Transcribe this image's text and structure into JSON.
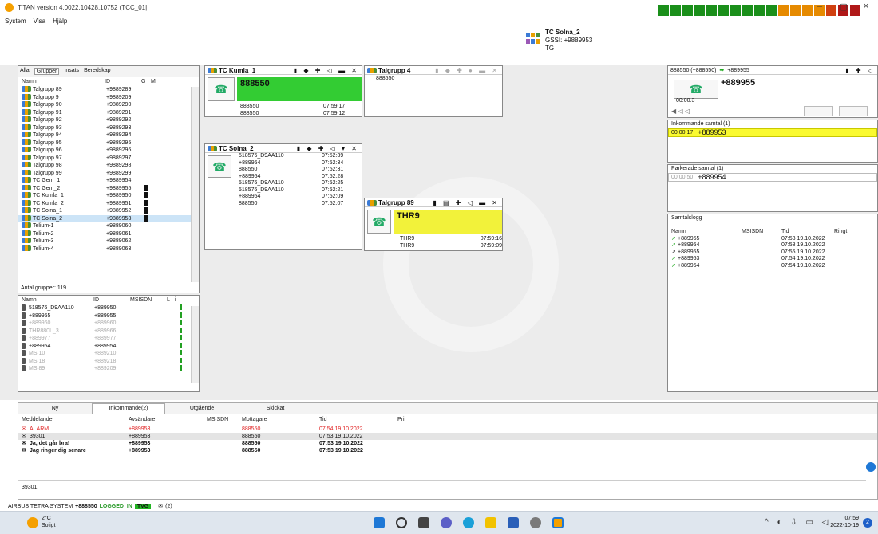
{
  "window": {
    "title": "TiTAN version 4.0022.10428.10752 (TCC_01|",
    "controls": [
      "–",
      "▢",
      "×"
    ],
    "status_colors": [
      "#1a8f1a",
      "#1a8f1a",
      "#1a8f1a",
      "#1a8f1a",
      "#1a8f1a",
      "#1a8f1a",
      "#1a8f1a",
      "#1a8f1a",
      "#1a8f1a",
      "#1a8f1a",
      "#e68a00",
      "#e68a00",
      "#e68a00",
      "#e68a00",
      "#d04010",
      "#b01818",
      "#b01818"
    ]
  },
  "menu": [
    "System",
    "Visa",
    "Hjälp"
  ],
  "active_call": {
    "name": "TC Solna_2",
    "gssi": "GSSI: +9889953",
    "type": "TG"
  },
  "group_list": {
    "tabs": [
      "Alla",
      "Grupper",
      "Insats",
      "Beredskap"
    ],
    "headers": [
      "Namn",
      "ID",
      "G",
      "M"
    ],
    "rows": [
      {
        "name": "Talgrupp 89",
        "id": "+9889289"
      },
      {
        "name": "Talgrupp 9",
        "id": "+9889209"
      },
      {
        "name": "Talgrupp 90",
        "id": "+9889290"
      },
      {
        "name": "Talgrupp 91",
        "id": "+9889291"
      },
      {
        "name": "Talgrupp 92",
        "id": "+9889292"
      },
      {
        "name": "Talgrupp 93",
        "id": "+9889293"
      },
      {
        "name": "Talgrupp 94",
        "id": "+9889294"
      },
      {
        "name": "Talgrupp 95",
        "id": "+9889295"
      },
      {
        "name": "Talgrupp 96",
        "id": "+9889296"
      },
      {
        "name": "Talgrupp 97",
        "id": "+9889297"
      },
      {
        "name": "Talgrupp 98",
        "id": "+9889298"
      },
      {
        "name": "Talgrupp 99",
        "id": "+9889299"
      },
      {
        "name": "TC Gem_1",
        "id": "+9889954"
      },
      {
        "name": "TC Gem_2",
        "id": "+9889955"
      },
      {
        "name": "TC Kumla_1",
        "id": "+9889950"
      },
      {
        "name": "TC Kumla_2",
        "id": "+9889951"
      },
      {
        "name": "TC Solna_1",
        "id": "+9889952"
      },
      {
        "name": "TC Solna_2",
        "id": "+9889953"
      },
      {
        "name": "Telium-1",
        "id": "+9889060"
      },
      {
        "name": "Telium-2",
        "id": "+9889061"
      },
      {
        "name": "Telium-3",
        "id": "+9889062"
      },
      {
        "name": "Telium-4",
        "id": "+9889063"
      }
    ],
    "count": "Antal grupper: 119"
  },
  "member_list": {
    "headers": [
      "Namn",
      "ID",
      "MSISDN",
      "L",
      "i"
    ],
    "rows": [
      {
        "name": "518576_D9AA110",
        "id": "+889950",
        "grey": false
      },
      {
        "name": "+889955",
        "id": "+889955",
        "grey": false
      },
      {
        "name": "+889960",
        "id": "+889960",
        "grey": true
      },
      {
        "name": "THR880L_3",
        "id": "+889966",
        "grey": true
      },
      {
        "name": "+889977",
        "id": "+889977",
        "grey": true
      },
      {
        "name": "+889954",
        "id": "+889954",
        "grey": false
      },
      {
        "name": "MS 10",
        "id": "+889210",
        "grey": true
      },
      {
        "name": "MS 18",
        "id": "+889218",
        "grey": true
      },
      {
        "name": "MS 89",
        "id": "+889209",
        "grey": true
      }
    ]
  },
  "tc_kumla": {
    "title": "TC Kumla_1",
    "banner": "888550",
    "banner_color": "#33cc33",
    "log": [
      {
        "src": "888550",
        "time": "07:59:17"
      },
      {
        "src": "888550",
        "time": "07:59:12"
      }
    ]
  },
  "talgrupp4": {
    "title": "Talgrupp 4",
    "line": "888550"
  },
  "tc_solna": {
    "title": "TC Solna_2",
    "log": [
      {
        "src": "518576_D9AA110",
        "time": "07:52:39"
      },
      {
        "src": "+889954",
        "time": "07:52:34"
      },
      {
        "src": "888550",
        "time": "07:52:31"
      },
      {
        "src": "+889954",
        "time": "07:52:28"
      },
      {
        "src": "518576_D9AA110",
        "time": "07:52:25"
      },
      {
        "src": "518576_D9AA110",
        "time": "07:52:21"
      },
      {
        "src": "+889954",
        "time": "07:52:09"
      },
      {
        "src": "888550",
        "time": "07:52:07"
      }
    ]
  },
  "talgrupp89": {
    "title": "Talgrupp 89",
    "banner": "THR9",
    "banner_color": "#f2f23a",
    "log": [
      {
        "src": "THR9",
        "time": "07:59:16"
      },
      {
        "src": "THR9",
        "time": "07:59:09"
      }
    ]
  },
  "private_call": {
    "header": "888550 (+888550)",
    "peer_header": "+889955",
    "peer": "+889955",
    "timer": "00:00.3"
  },
  "incoming": {
    "title": "Inkommande samtal (1)",
    "time": "00:00.17",
    "number": "+889953"
  },
  "parked": {
    "title": "Parkerade samtal (1)",
    "time": "00:00.50",
    "number": "+889954"
  },
  "call_log": {
    "title": "Samtalslogg",
    "headers": [
      "Namn",
      "MSISDN",
      "Tid",
      "Ringt"
    ],
    "rows": [
      {
        "name": "+889955",
        "time": "07:58 19.10.2022",
        "icon": "#22aa22"
      },
      {
        "name": "+889954",
        "time": "07:58 19.10.2022",
        "icon": "#22aa22"
      },
      {
        "name": "+889955",
        "time": "07:55 19.10.2022",
        "icon": "#222222"
      },
      {
        "name": "+889953",
        "time": "07:54 19.10.2022",
        "icon": "#22aa22"
      },
      {
        "name": "+889954",
        "time": "07:54 19.10.2022",
        "icon": "#22aa22"
      }
    ]
  },
  "messages": {
    "tabs": [
      "Ny",
      "Inkommande(2)",
      "Utgående",
      "Skickat"
    ],
    "headers": [
      "Meddelande",
      "Avsändare",
      "MSISDN",
      "Mottagare",
      "Tid",
      "Pri"
    ],
    "rows": [
      {
        "msg": "ALARM",
        "from": "+889953",
        "to": "888550",
        "time": "07:54 19.10.2022",
        "style": "red"
      },
      {
        "msg": "39301",
        "from": "+889953",
        "to": "888550",
        "time": "07:53 19.10.2022",
        "style": "sel"
      },
      {
        "msg": "Ja, det går bra!",
        "from": "+889953",
        "to": "888550",
        "time": "07:53 19.10.2022",
        "style": "bold"
      },
      {
        "msg": "Jag ringer dig senare",
        "from": "+889953",
        "to": "888550",
        "time": "07:53 19.10.2022",
        "style": "bold"
      }
    ],
    "preview": "39301"
  },
  "statusline": {
    "system": "AIRBUS TETRA SYSTEM",
    "user": "+888550",
    "state": "LOGGED_IN",
    "tvg": "TVG",
    "mail": "(2)"
  },
  "taskbar": {
    "temp": "2°C",
    "weather": "Soligt",
    "time": "07:59",
    "date": "2022-10-19",
    "badge": "2"
  }
}
